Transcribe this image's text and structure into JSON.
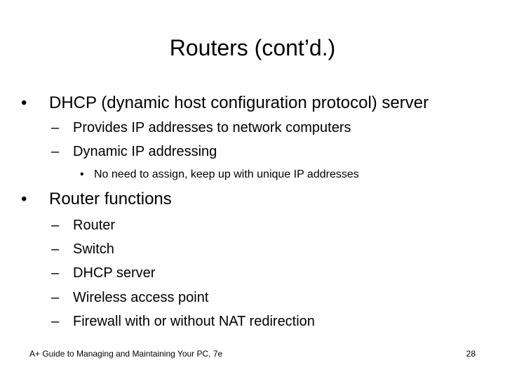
{
  "slide": {
    "title": "Routers (cont’d.)",
    "bullets": [
      {
        "marker": "•",
        "text": "DHCP (dynamic host configuration protocol) server",
        "sub": [
          {
            "marker": "–",
            "text": "Provides IP addresses to network computers"
          },
          {
            "marker": "–",
            "text": "Dynamic IP addressing",
            "sub": [
              {
                "marker": "•",
                "text": "No need to assign, keep up with unique IP addresses"
              }
            ]
          }
        ]
      },
      {
        "marker": "•",
        "text": "Router functions",
        "sub": [
          {
            "marker": "–",
            "text": "Router"
          },
          {
            "marker": "–",
            "text": "Switch"
          },
          {
            "marker": "–",
            "text": "DHCP server"
          },
          {
            "marker": "–",
            "text": "Wireless access point"
          },
          {
            "marker": "–",
            "text": "Firewall with or without NAT redirection"
          }
        ]
      }
    ]
  },
  "footer": {
    "left": "A+ Guide to Managing and Maintaining Your PC, 7e",
    "page_number": "28"
  }
}
